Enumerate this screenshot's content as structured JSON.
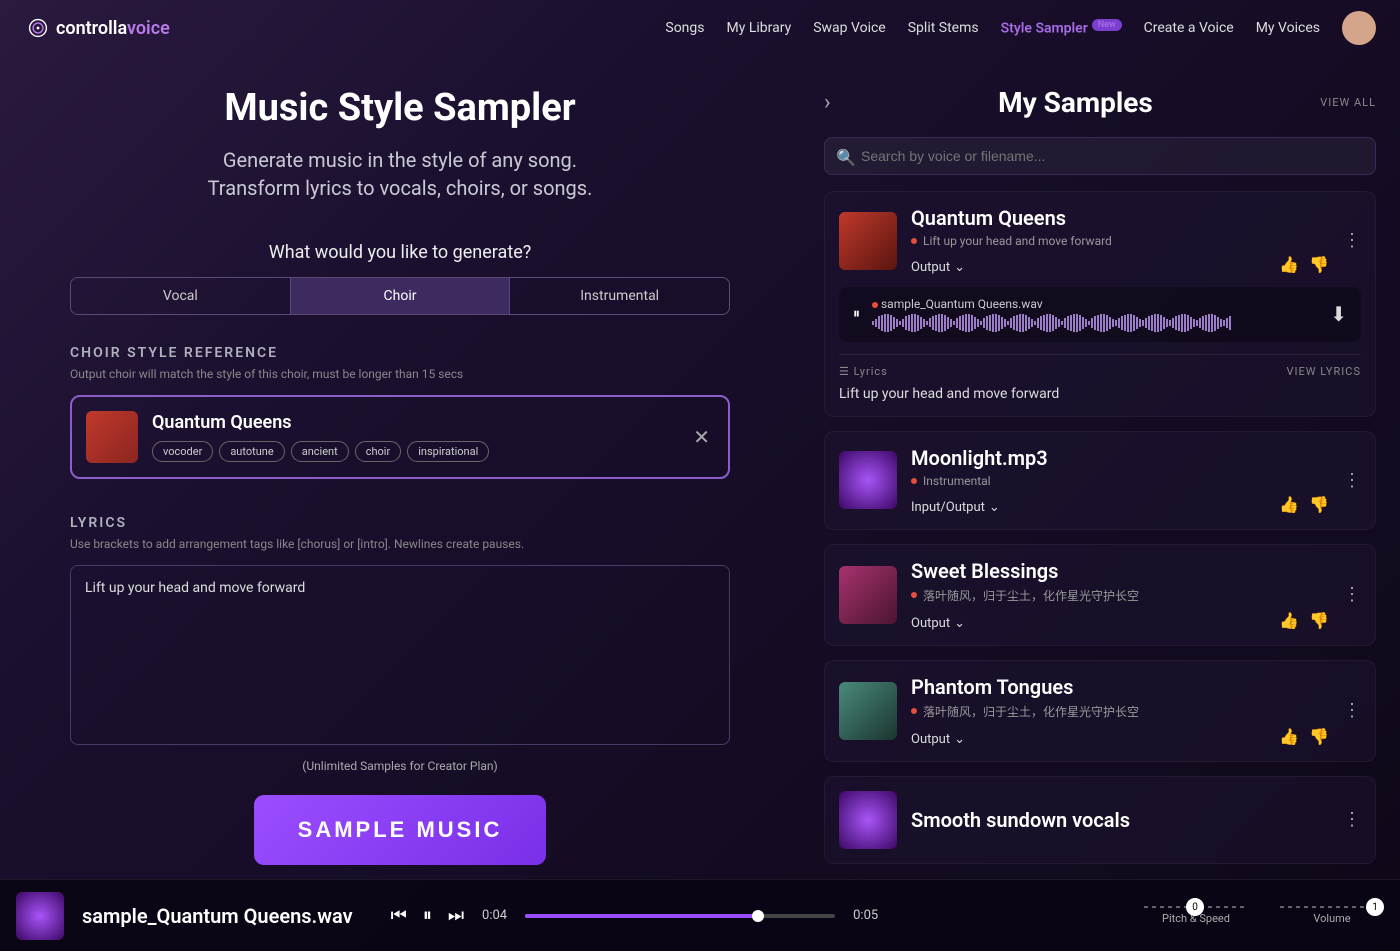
{
  "logo": {
    "prefix": "controlla",
    "suffix": "voice"
  },
  "nav": {
    "items": [
      "Songs",
      "My Library",
      "Swap Voice",
      "Split Stems",
      "Style Sampler",
      "Create a Voice",
      "My Voices"
    ],
    "active_index": 4,
    "new_badge": "New"
  },
  "left": {
    "title": "Music Style Sampler",
    "subtitle1": "Generate music in the style of any song.",
    "subtitle2": "Transform lyrics to vocals, choirs, or songs.",
    "question": "What would you like to generate?",
    "tabs": [
      "Vocal",
      "Choir",
      "Instrumental"
    ],
    "active_tab": 1,
    "reference": {
      "section_title": "CHOIR STYLE REFERENCE",
      "section_sub": "Output choir will match the style of this choir, must be longer than 15 secs",
      "title": "Quantum Queens",
      "chips": [
        "vocoder",
        "autotune",
        "ancient",
        "choir",
        "inspirational"
      ]
    },
    "lyrics": {
      "section_title": "LYRICS",
      "section_sub": "Use brackets to add arrangement tags like [chorus] or [intro]. Newlines create pauses.",
      "value": "Lift up your head and move forward"
    },
    "plan_note": "(Unlimited Samples for Creator Plan)",
    "sample_button": "SAMPLE MUSIC"
  },
  "right": {
    "title": "My Samples",
    "view_all": "VIEW ALL",
    "search_placeholder": "Search by voice or filename...",
    "samples": [
      {
        "title": "Quantum Queens",
        "sub": "Lift up your head and move forward",
        "foot": "Output",
        "expanded": true,
        "thumb_class": "thumb-red",
        "wave_name": "sample_Quantum Queens.wav",
        "lyrics_label": "Lyrics",
        "view_lyrics": "VIEW LYRICS",
        "lyric_line": "Lift up your head and move forward"
      },
      {
        "title": "Moonlight.mp3",
        "sub": "Instrumental",
        "foot": "Input/Output",
        "thumb_class": "thumb-purple"
      },
      {
        "title": "Sweet Blessings",
        "sub": "落叶随风，归于尘土，化作星光守护长空",
        "foot": "Output",
        "thumb_class": "thumb-pink"
      },
      {
        "title": "Phantom Tongues",
        "sub": "落叶随风，归于尘土，化作星光守护长空",
        "foot": "Output",
        "thumb_class": "thumb-teal"
      },
      {
        "title": "Smooth sundown vocals",
        "sub": "",
        "foot": "",
        "thumb_class": "thumb-purple"
      }
    ]
  },
  "player": {
    "track_name": "sample_Quantum Queens.wav",
    "pos": "0:04",
    "dur": "0:05",
    "pitch_label": "Pitch & Speed",
    "pitch_val": "0",
    "vol_label": "Volume",
    "vol_val": "1"
  }
}
